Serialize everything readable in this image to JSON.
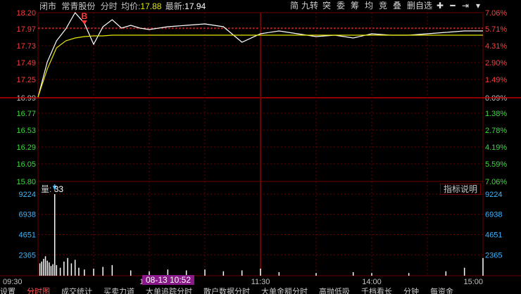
{
  "header": {
    "status": "闭市",
    "stock_name": "常青股份",
    "mode": "分时",
    "avg_label": "均价:",
    "avg_value": "17.88",
    "latest_label": "最新:",
    "latest_value": "17.94"
  },
  "toolbar": {
    "buttons": [
      "简",
      "九转",
      "突",
      "委",
      "筹",
      "均",
      "竞",
      "叠",
      "删自选"
    ],
    "icons": [
      "plus-icon",
      "minus-icon",
      "jump-right-icon",
      "dropdown-icon"
    ]
  },
  "volume_panel": {
    "label": "量:",
    "value": "33",
    "help_button": "指标说明"
  },
  "crosshair_date": "08-13 10:52",
  "tabs": [
    "设置",
    "分时图",
    "成交统计",
    "买卖力道",
    "大单追踪分时",
    "散户数据分时",
    "大单金额分时",
    "高抛低吸",
    "千档看长",
    "分钟",
    "每资金"
  ],
  "colors": {
    "background": "#000000",
    "grid": "#6e0000",
    "price_line": "#ffffff",
    "avg_line": "#e6e600",
    "up": "#ff3c3c",
    "down": "#3cdc3c",
    "axis_neutral": "#c0c0c0",
    "volume": "#ffffff",
    "accent": "#3cb4ff"
  },
  "chart_data": [
    {
      "type": "line",
      "name": "intraday-price",
      "x": [
        "09:30",
        "09:35",
        "09:40",
        "09:45",
        "09:50",
        "09:55",
        "10:00",
        "10:05",
        "10:10",
        "10:15",
        "10:20",
        "10:25",
        "10:30",
        "10:40",
        "10:50",
        "11:00",
        "11:10",
        "11:20",
        "11:30",
        "13:10",
        "13:20",
        "13:30",
        "13:40",
        "13:50",
        "14:00",
        "14:10",
        "14:20",
        "14:30",
        "14:40",
        "14:50",
        "15:00"
      ],
      "x_ticks": [
        "09:30",
        "10:30",
        "11:30",
        "14:00",
        "15:00"
      ],
      "series": [
        {
          "values": [
            17.0,
            17.5,
            17.8,
            17.97,
            18.2,
            18.05,
            17.75,
            18.0,
            18.1,
            17.98,
            18.02,
            17.98,
            17.96,
            18.0,
            18.02,
            18.04,
            18.0,
            17.78,
            17.9,
            17.94,
            17.9,
            17.86,
            17.88,
            17.84,
            17.9,
            17.88,
            17.88,
            17.9,
            17.92,
            17.94,
            17.94
          ]
        },
        {
          "values": [
            17.0,
            17.4,
            17.7,
            17.8,
            17.84,
            17.86,
            17.87,
            17.87,
            17.88,
            17.88,
            17.88,
            17.88,
            17.88,
            17.88,
            17.88,
            17.88,
            17.88,
            17.88,
            17.88,
            17.88,
            17.88,
            17.88,
            17.88,
            17.88,
            17.88,
            17.88,
            17.88,
            17.88,
            17.88,
            17.88,
            17.88
          ]
        }
      ],
      "y_ticks_left": [
        "18.20",
        "17.97",
        "17.73",
        "17.49",
        "17.25",
        "16.99",
        "16.77",
        "16.53",
        "16.29",
        "16.05",
        "15.80"
      ],
      "y_ticks_right": [
        "7.06%",
        "5.71%",
        "4.31%",
        "2.90%",
        "1.49%",
        "0.09%",
        "1.38%",
        "2.78%",
        "4.19%",
        "5.59%",
        "7.06%"
      ],
      "ylim": [
        15.8,
        18.2
      ],
      "reference_price": 16.99,
      "annotations": [
        {
          "text": "B",
          "x": "09:55",
          "y": 18.05
        }
      ]
    },
    {
      "type": "bar",
      "name": "volume",
      "x": [
        "09:31",
        "09:32",
        "09:33",
        "09:34",
        "09:35",
        "09:36",
        "09:37",
        "09:38",
        "09:39",
        "09:40",
        "09:42",
        "09:44",
        "09:46",
        "09:48",
        "09:50",
        "09:52",
        "09:55",
        "10:00",
        "10:05",
        "10:10",
        "10:20",
        "10:30",
        "10:40",
        "10:50",
        "11:00",
        "11:10",
        "11:20",
        "11:30",
        "13:10",
        "13:30",
        "13:50",
        "14:00",
        "14:20",
        "14:40",
        "14:50",
        "15:00"
      ],
      "values": [
        1400,
        1600,
        1900,
        2200,
        1700,
        1500,
        1100,
        1300,
        9224,
        1200,
        900,
        1600,
        2000,
        1400,
        1800,
        900,
        700,
        800,
        1000,
        1200,
        600,
        500,
        700,
        600,
        700,
        500,
        600,
        800,
        400,
        300,
        400,
        300,
        300,
        500,
        900,
        2000
      ],
      "y_ticks": [
        "9224",
        "6938",
        "4651",
        "2365"
      ],
      "ylim": [
        0,
        9224
      ]
    }
  ]
}
